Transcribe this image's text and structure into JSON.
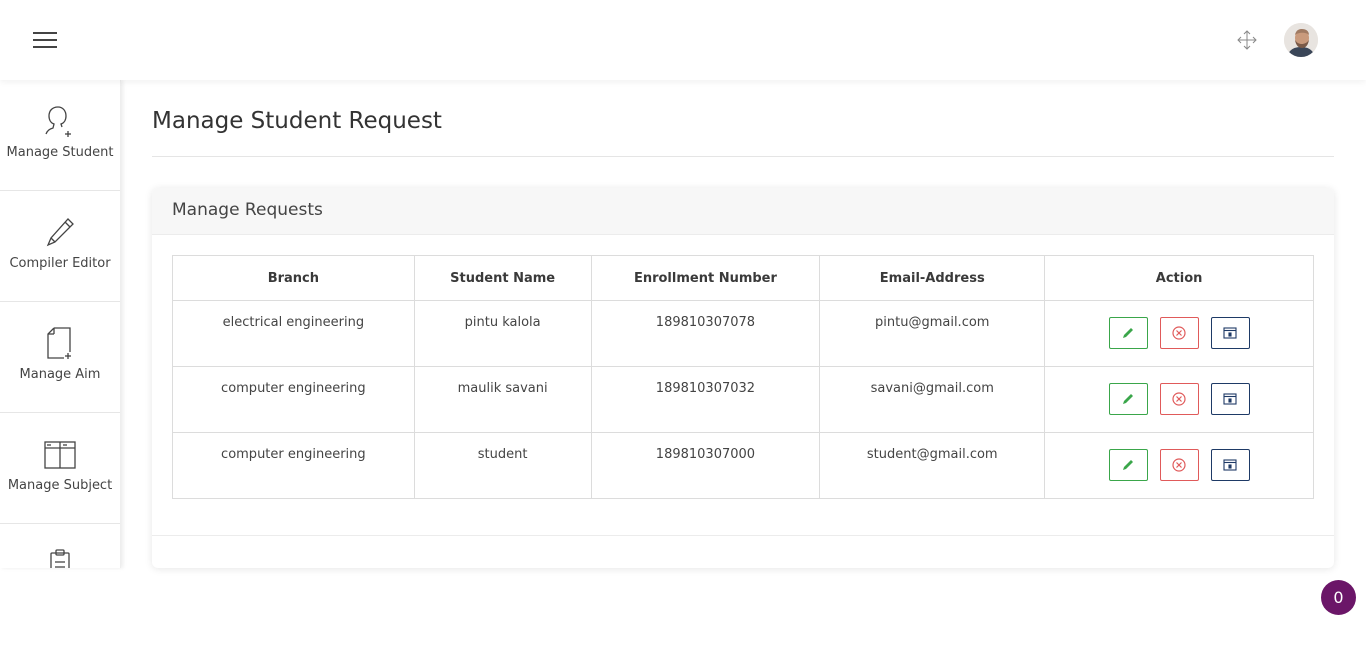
{
  "header": {
    "menu_icon": "hamburger-icon",
    "fullscreen_icon": "expand-arrows-icon",
    "avatar_icon": "user-avatar"
  },
  "sidebar": {
    "items": [
      {
        "label": "Manage Student",
        "icon": "user-add-icon"
      },
      {
        "label": "Compiler Editor",
        "icon": "pencil-icon"
      },
      {
        "label": "Manage Aim",
        "icon": "file-add-icon"
      },
      {
        "label": "Manage Subject",
        "icon": "layout-icon"
      },
      {
        "label": "",
        "icon": "clipboard-icon"
      }
    ]
  },
  "main": {
    "page_title": "Manage Student Request",
    "card_title": "Manage Requests",
    "table": {
      "headers": [
        "Branch",
        "Student Name",
        "Enrollment Number",
        "Email-Address",
        "Action"
      ],
      "rows": [
        {
          "branch": "electrical engineering",
          "name": "pintu kalola",
          "enrollment": "189810307078",
          "email": "pintu@gmail.com"
        },
        {
          "branch": "computer engineering",
          "name": "maulik savani",
          "enrollment": "189810307032",
          "email": "savani@gmail.com"
        },
        {
          "branch": "computer engineering",
          "name": "student",
          "enrollment": "189810307000",
          "email": "student@gmail.com"
        }
      ],
      "action_icons": [
        "pencil-icon",
        "close-circle-icon",
        "calendar-icon"
      ]
    }
  },
  "badge": {
    "count": "0"
  },
  "colors": {
    "edit": "#3aa64a",
    "delete": "#e05a5a",
    "view": "#1e3a66",
    "badge": "#6b1668"
  }
}
